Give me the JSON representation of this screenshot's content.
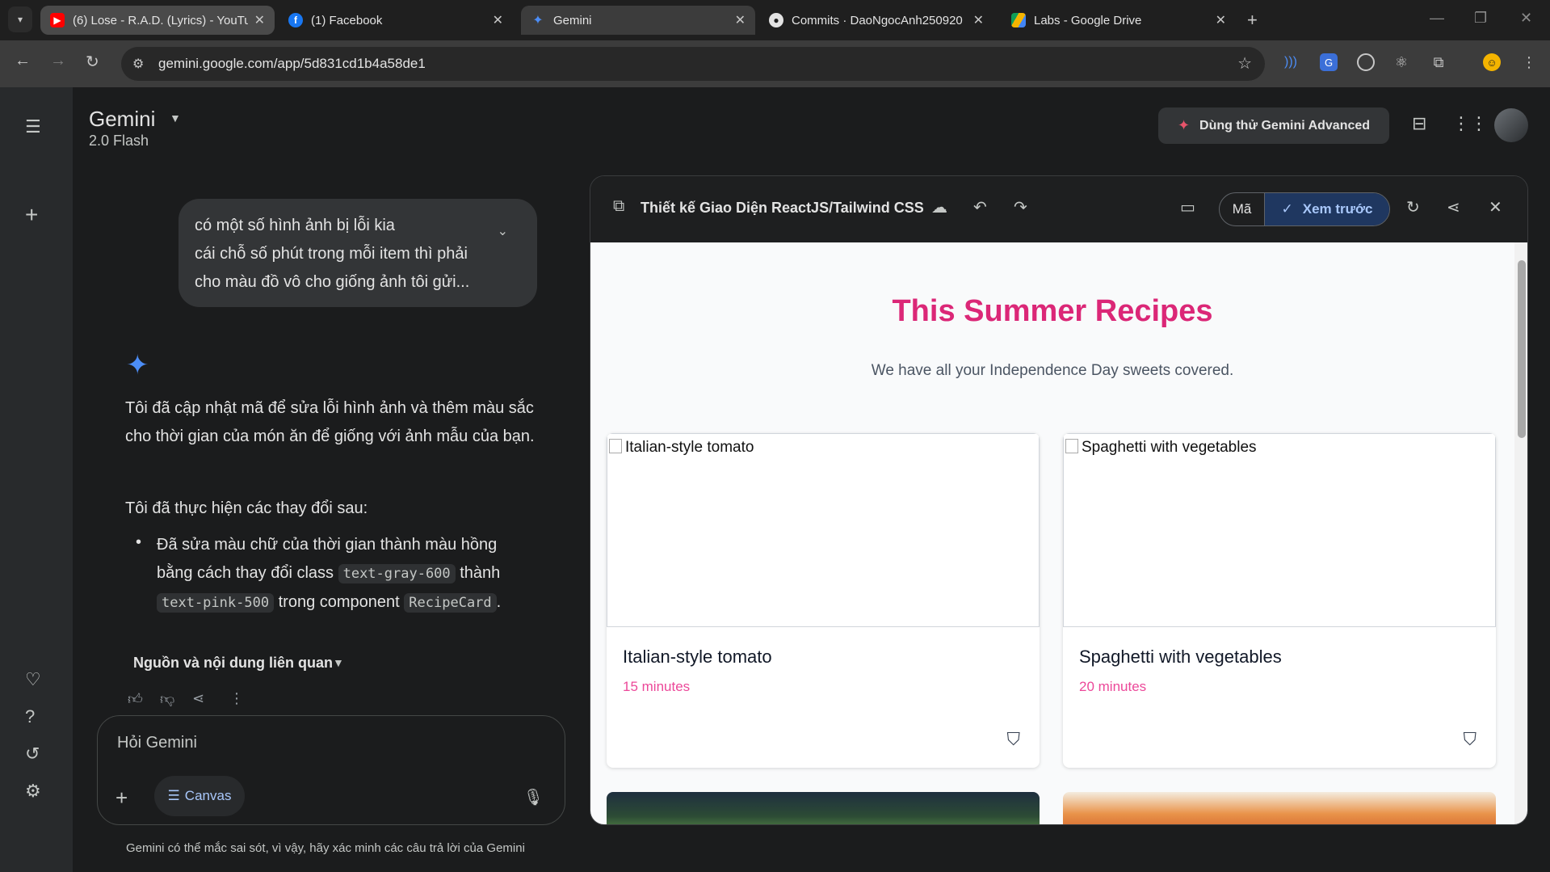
{
  "browser": {
    "tabs": [
      {
        "title": "(6) Lose - R.A.D. (Lyrics) - YouTu",
        "close": "✕"
      },
      {
        "title": "(1) Facebook",
        "close": "✕"
      },
      {
        "title": "Gemini",
        "close": "✕"
      },
      {
        "title": "Commits · DaoNgocAnh250920",
        "close": "✕"
      },
      {
        "title": "Labs - Google Drive",
        "close": "✕"
      }
    ],
    "url": "gemini.google.com/app/5d831cd1b4a58de1"
  },
  "app": {
    "brand": "Gemini",
    "model": "2.0 Flash",
    "advanced_button": "Dùng thử Gemini Advanced"
  },
  "chat": {
    "user_lines": [
      "có một số hình ảnh bị lỗi kia",
      "cái chỗ số phút trong mỗi item thì phải",
      "cho màu đồ vô cho giống ảnh tôi gửi..."
    ],
    "response_p1": "Tôi đã cập nhật mã để sửa lỗi hình ảnh và thêm màu sắc cho thời gian của món ăn để giống với ảnh mẫu của bạn.",
    "response_p2": "Tôi đã thực hiện các thay đổi sau:",
    "bullet_a": "Đã sửa màu chữ của thời gian thành màu hồng bằng cách thay đổi class",
    "bullet_code1": "text-gray-600",
    "bullet_b": "thành",
    "bullet_code2": "text-pink-500",
    "bullet_c": "trong component",
    "bullet_code3": "RecipeCard",
    "bullet_end": ".",
    "sources": "Nguồn và nội dung liên quan",
    "input_placeholder": "Hỏi Gemini",
    "canvas_chip": "Canvas",
    "disclaimer": "Gemini có thể mắc sai sót, vì vậy, hãy xác minh các câu trả lời của Gemini"
  },
  "canvas": {
    "title": "Thiết kế Giao Diện ReactJS/Tailwind CSS",
    "code_tab": "Mã",
    "preview_tab": "Xem trước"
  },
  "preview": {
    "heading": "This Summer Recipes",
    "subheading": "We have all your Independence Day sweets covered.",
    "recipes": [
      {
        "name": "Italian-style tomato",
        "time": "15 minutes",
        "alt": "Italian-style tomato"
      },
      {
        "name": "Spaghetti with vegetables",
        "time": "20 minutes",
        "alt": "Spaghetti with vegetables"
      }
    ]
  },
  "colors": {
    "accent_pink": "#db2777",
    "time_pink": "#ec4899",
    "gemini_blue": "#4c8df6"
  }
}
